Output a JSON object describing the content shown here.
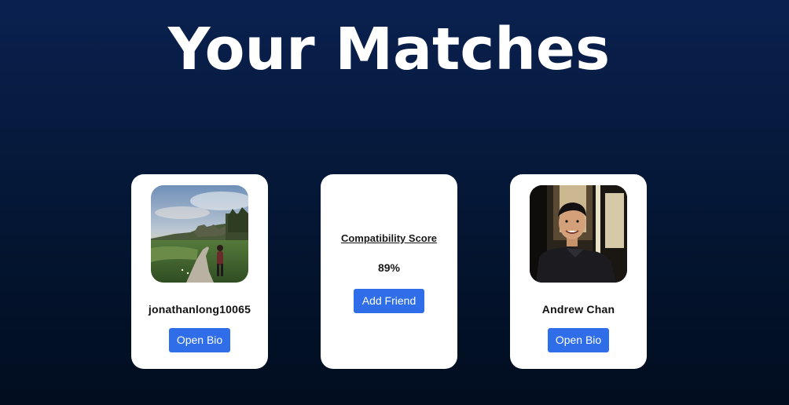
{
  "page": {
    "title": "Your Matches"
  },
  "matches": [
    {
      "username": "jonathanlong10065",
      "button_label": "Open Bio",
      "photo_alt": "profile photo"
    },
    {
      "username": "Andrew Chan",
      "button_label": "Open Bio",
      "photo_alt": "profile photo"
    }
  ],
  "compatibility": {
    "label": "Compatibility Score",
    "value": "89%",
    "button_label": "Add Friend"
  },
  "colors": {
    "background_top": "#0a2150",
    "background_bottom": "#020d1f",
    "card": "#ffffff",
    "button": "#2f6ee8"
  }
}
